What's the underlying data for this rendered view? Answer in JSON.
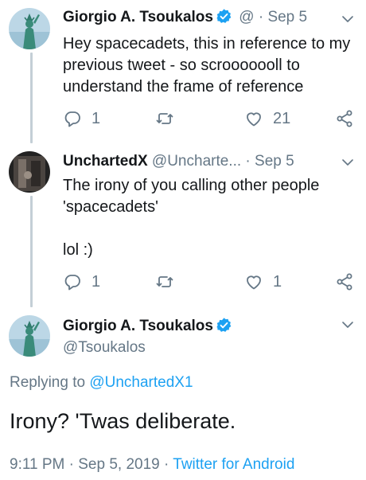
{
  "tweets": [
    {
      "name": "Giorgio A. Tsoukalos",
      "handle": "@",
      "dot": "·",
      "date": "Sep 5",
      "text": "Hey spacecadets, this in reference to my previous tweet - so scrooooooll to understand the frame of reference",
      "replies": "1",
      "retweets": "",
      "likes": "21"
    },
    {
      "name": "UnchartedX",
      "handle": "@Uncharte...",
      "dot": "·",
      "date": "Sep 5",
      "text": "The irony of you calling other people 'spacecadets'\n\nlol :)",
      "replies": "1",
      "retweets": "",
      "likes": "1"
    }
  ],
  "main": {
    "name": "Giorgio A. Tsoukalos",
    "handle": "@Tsoukalos",
    "replying_prefix": "Replying to ",
    "replying_handle": "@UnchartedX1",
    "text": "Irony? 'Twas deliberate.",
    "time": "9:11 PM",
    "sep1": "·",
    "date": "Sep 5, 2019",
    "sep2": "·",
    "source": "Twitter for Android"
  },
  "colors": {
    "link": "#1da1f2",
    "muted": "#657786",
    "verified": "#1da1f2"
  },
  "icons": [
    "reply-icon",
    "retweet-icon",
    "like-icon",
    "share-icon",
    "chevron-down-icon",
    "verified-badge-icon"
  ]
}
